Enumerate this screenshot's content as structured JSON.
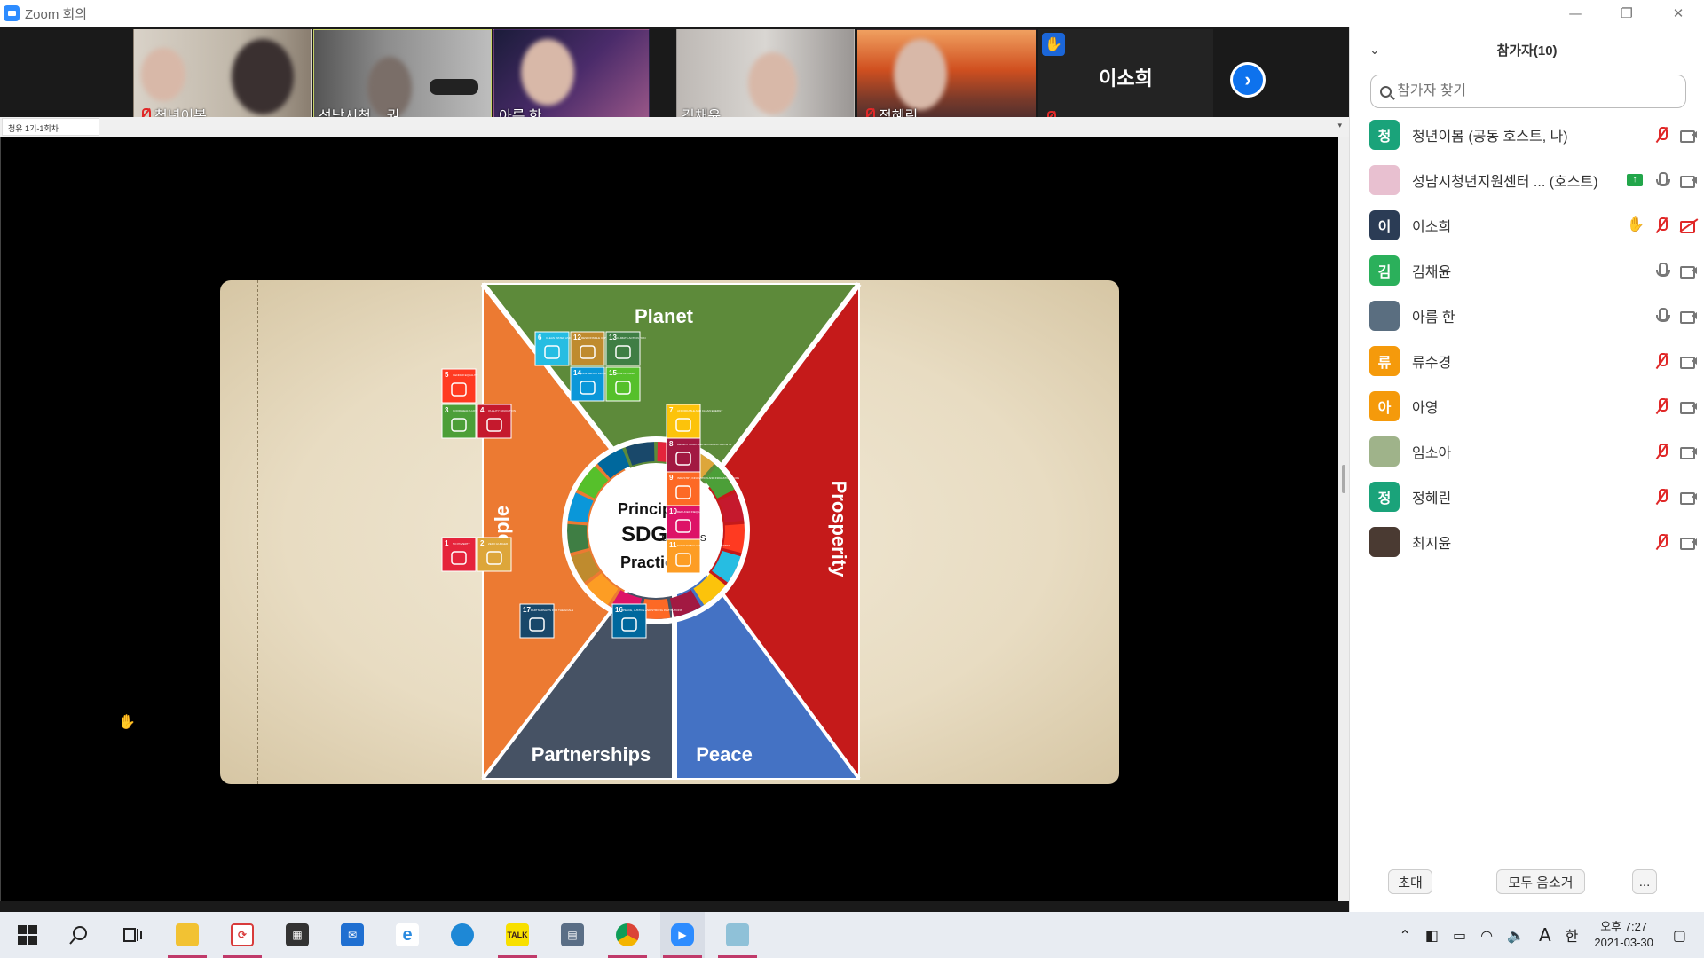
{
  "window": {
    "title": "Zoom 회의",
    "controls": [
      "—",
      "❐",
      "✕"
    ]
  },
  "thumbnails": [
    {
      "name": "청년이봄",
      "muted": true
    },
    {
      "name": "성남시청 ...권...",
      "muted": false
    },
    {
      "name": "아름 한",
      "muted": false
    },
    {
      "name": "김채윤",
      "muted": false
    },
    {
      "name": "정혜린",
      "muted": true
    }
  ],
  "featured_thumb": {
    "name": "이소희",
    "hand_raised": true,
    "muted": true
  },
  "share": {
    "tab_label": "청유 1기-1회차"
  },
  "slide": {
    "center_lines": [
      "Principles",
      "SDG",
      ".SERVICES",
      "Practices"
    ],
    "sections": {
      "planet": "Planet",
      "people": "People",
      "prosperity": "Prosperity",
      "partnerships": "Partnerships",
      "peace": "Peace"
    },
    "goals": {
      "g1": {
        "num": "1",
        "label": "NO POVERTY",
        "color": "#e5243b"
      },
      "g2": {
        "num": "2",
        "label": "ZERO HUNGER",
        "color": "#dda63a"
      },
      "g3": {
        "num": "3",
        "label": "GOOD HEALTH AND WELL-BEING",
        "color": "#4c9f38"
      },
      "g4": {
        "num": "4",
        "label": "QUALITY EDUCATION",
        "color": "#c5192d"
      },
      "g5": {
        "num": "5",
        "label": "GENDER EQUALITY",
        "color": "#ff3a21"
      },
      "g6": {
        "num": "6",
        "label": "CLEAN WATER AND SANITATION",
        "color": "#26bde2"
      },
      "g7": {
        "num": "7",
        "label": "AFFORDABLE AND CLEAN ENERGY",
        "color": "#fcc30b"
      },
      "g8": {
        "num": "8",
        "label": "DECENT WORK AND ECONOMIC GROWTH",
        "color": "#a21942"
      },
      "g9": {
        "num": "9",
        "label": "INDUSTRY, INNOVATION AND INFRASTRUCTURE",
        "color": "#fd6925"
      },
      "g10": {
        "num": "10",
        "label": "REDUCED INEQUALITIES",
        "color": "#dd1367"
      },
      "g11": {
        "num": "11",
        "label": "SUSTAINABLE CITIES AND COMMUNITIES",
        "color": "#fd9d24"
      },
      "g12": {
        "num": "12",
        "label": "RESPONSIBLE CONSUMPTION AND PRODUCTION",
        "color": "#bf8b2e"
      },
      "g13": {
        "num": "13",
        "label": "CLIMATE ACTION",
        "color": "#3f7e44"
      },
      "g14": {
        "num": "14",
        "label": "LIFE BELOW WATER",
        "color": "#0a97d9"
      },
      "g15": {
        "num": "15",
        "label": "LIFE ON LAND",
        "color": "#56c02b"
      },
      "g16": {
        "num": "16",
        "label": "PEACE, JUSTICE AND STRONG INSTITUTIONS",
        "color": "#00689d"
      },
      "g17": {
        "num": "17",
        "label": "PARTNERSHIPS FOR THE GOALS",
        "color": "#19486a"
      }
    }
  },
  "panel": {
    "title": "참가자(10)",
    "search_placeholder": "참가자 찾기",
    "participants": [
      {
        "avatar_text": "청",
        "avatar_color": "#1aa37a",
        "name": "청년이봄 (공동 호스트, 나)",
        "icons": [
          "mic-off",
          "cam"
        ]
      },
      {
        "avatar_text": "",
        "avatar_color": "#e8c0d0",
        "name": "성남시청년지원센터 ... (호스트)",
        "icons": [
          "share",
          "mic",
          "cam"
        ]
      },
      {
        "avatar_text": "이",
        "avatar_color": "#2b3c55",
        "name": "이소희",
        "icons": [
          "hand",
          "mic-off",
          "cam-off"
        ]
      },
      {
        "avatar_text": "김",
        "avatar_color": "#2bb05b",
        "name": "김채윤",
        "icons": [
          "mic",
          "cam"
        ]
      },
      {
        "avatar_text": "",
        "avatar_color": "#5a6e80",
        "name": "아름 한",
        "icons": [
          "mic",
          "cam"
        ]
      },
      {
        "avatar_text": "류",
        "avatar_color": "#f59a0b",
        "name": "류수경",
        "icons": [
          "mic-off",
          "cam"
        ]
      },
      {
        "avatar_text": "아",
        "avatar_color": "#f59a0b",
        "name": "아영",
        "icons": [
          "mic-off",
          "cam"
        ]
      },
      {
        "avatar_text": "",
        "avatar_color": "#9fb38a",
        "name": "임소아",
        "icons": [
          "mic-off",
          "cam"
        ]
      },
      {
        "avatar_text": "정",
        "avatar_color": "#1aa37a",
        "name": "정혜린",
        "icons": [
          "mic-off",
          "cam"
        ]
      },
      {
        "avatar_text": "",
        "avatar_color": "#4a3a32",
        "name": "최지윤",
        "icons": [
          "mic-off",
          "cam"
        ]
      }
    ],
    "footer": {
      "invite": "초대",
      "mute_all": "모두 음소거",
      "more": "..."
    }
  },
  "taskbar": {
    "apps": [
      "start-icon",
      "search-icon",
      "task-view-icon",
      "file-explorer-icon",
      "sync-icon",
      "store-icon",
      "mail-icon",
      "ie-icon",
      "edge-icon",
      "kakaotalk-icon",
      "calculator-icon",
      "chrome-icon",
      "zoom-icon",
      "app-icon"
    ],
    "kakao_label": "TALK",
    "ime": "한",
    "font_glyph": "A",
    "time": "오후 7:27",
    "date": "2021-03-30"
  }
}
